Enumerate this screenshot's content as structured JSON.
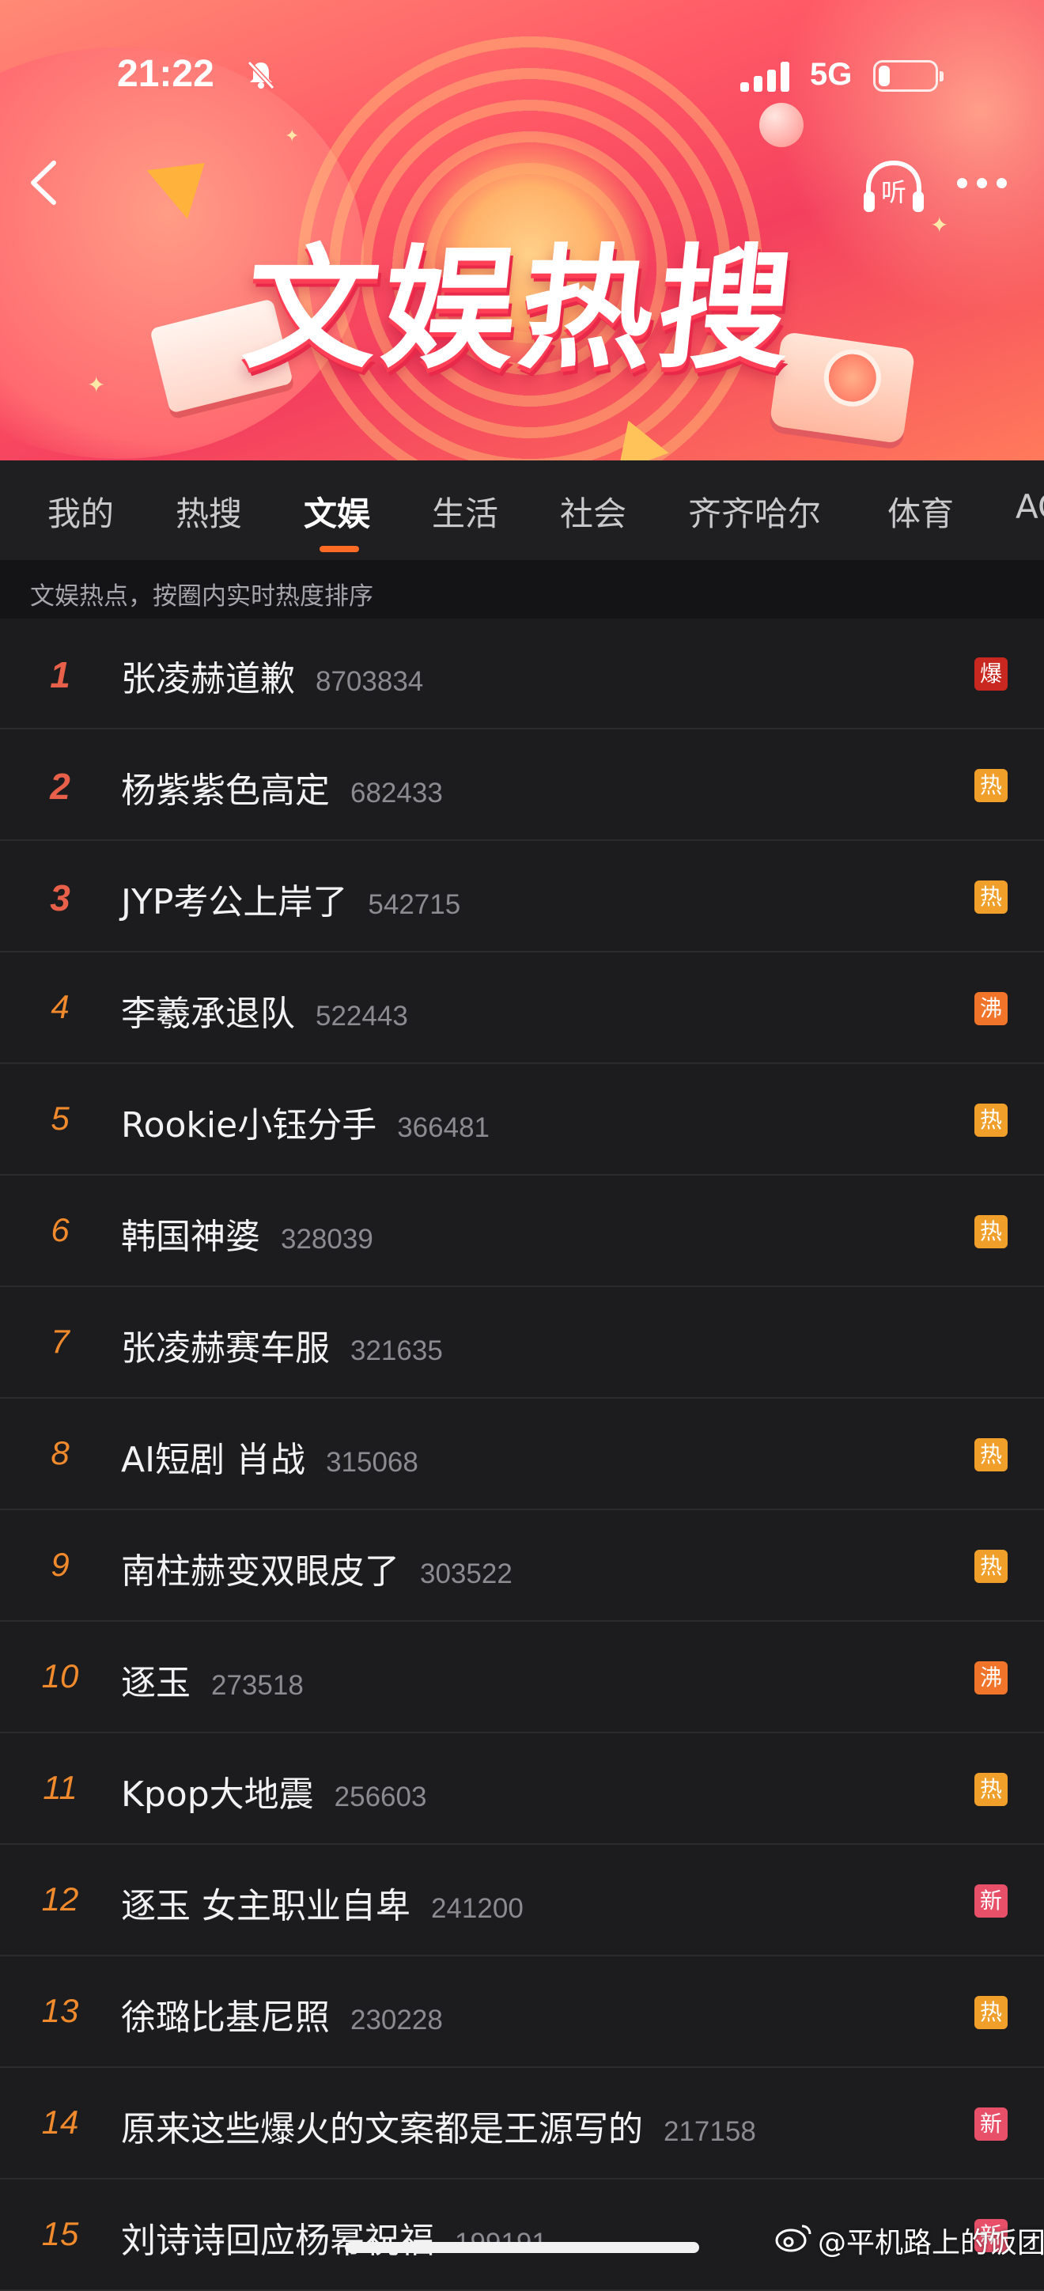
{
  "status_bar": {
    "time": "21:22",
    "network": "5G",
    "battery_level": 0.15
  },
  "header": {
    "banner_title": "文娱热搜",
    "listen_label": "听"
  },
  "tabs": [
    {
      "label": "我的"
    },
    {
      "label": "热搜"
    },
    {
      "label": "文娱",
      "active": true
    },
    {
      "label": "生活"
    },
    {
      "label": "社会"
    },
    {
      "label": "齐齐哈尔"
    },
    {
      "label": "体育"
    },
    {
      "label": "AC"
    }
  ],
  "subtitle": "文娱热点，按圈内实时热度排序",
  "colors": {
    "accent": "#ff6a24",
    "badge_bao": "#c8281f",
    "badge_re": "#f0a02a",
    "badge_fei": "#f0742a",
    "badge_xin": "#e8506a"
  },
  "trends": [
    {
      "rank": "1",
      "title": "张凌赫道歉",
      "count": "8703834",
      "badge": "爆",
      "badge_color": "#c8281f"
    },
    {
      "rank": "2",
      "title": "杨紫紫色高定",
      "count": "682433",
      "badge": "热",
      "badge_color": "#f0a02a"
    },
    {
      "rank": "3",
      "title": "JYP考公上岸了",
      "count": "542715",
      "badge": "热",
      "badge_color": "#f0a02a"
    },
    {
      "rank": "4",
      "title": "李羲承退队",
      "count": "522443",
      "badge": "沸",
      "badge_color": "#f0742a"
    },
    {
      "rank": "5",
      "title": "Rookie小钰分手",
      "count": "366481",
      "badge": "热",
      "badge_color": "#f0a02a"
    },
    {
      "rank": "6",
      "title": "韩国神婆",
      "count": "328039",
      "badge": "热",
      "badge_color": "#f0a02a"
    },
    {
      "rank": "7",
      "title": "张凌赫赛车服",
      "count": "321635",
      "badge": "",
      "badge_color": ""
    },
    {
      "rank": "8",
      "title": "AI短剧 肖战",
      "count": "315068",
      "badge": "热",
      "badge_color": "#f0a02a"
    },
    {
      "rank": "9",
      "title": "南柱赫变双眼皮了",
      "count": "303522",
      "badge": "热",
      "badge_color": "#f0a02a"
    },
    {
      "rank": "10",
      "title": "逐玉",
      "count": "273518",
      "badge": "沸",
      "badge_color": "#f0742a"
    },
    {
      "rank": "11",
      "title": "Kpop大地震",
      "count": "256603",
      "badge": "热",
      "badge_color": "#f0a02a"
    },
    {
      "rank": "12",
      "title": "逐玉 女主职业自卑",
      "count": "241200",
      "badge": "新",
      "badge_color": "#e8506a"
    },
    {
      "rank": "13",
      "title": "徐璐比基尼照",
      "count": "230228",
      "badge": "热",
      "badge_color": "#f0a02a"
    },
    {
      "rank": "14",
      "title": "原来这些爆火的文案都是王源写的",
      "count": "217158",
      "badge": "新",
      "badge_color": "#e8506a"
    },
    {
      "rank": "15",
      "title": "刘诗诗回应杨幂祝福",
      "count": "199191",
      "badge": "新",
      "badge_color": "#e8506a"
    }
  ],
  "watermark": "@平机路上的饭团"
}
